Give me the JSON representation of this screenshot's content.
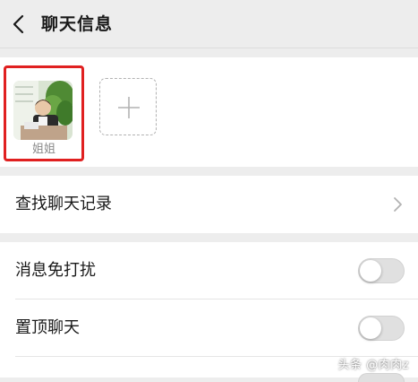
{
  "header": {
    "title": "聊天信息"
  },
  "members": [
    {
      "name": "姐姐"
    }
  ],
  "rows": {
    "search_history": "查找聊天记录",
    "mute": {
      "label": "消息免打扰",
      "on": false
    },
    "pin": {
      "label": "置顶聊天",
      "on": false
    }
  },
  "watermark": "头条 @肉肉z",
  "colors": {
    "highlight": "#e02020",
    "background": "#ededed",
    "toggle_off": "#e0e0e0"
  },
  "icons": {
    "back": "chevron-left-icon",
    "add": "plus-icon",
    "more": "chevron-right-icon"
  }
}
